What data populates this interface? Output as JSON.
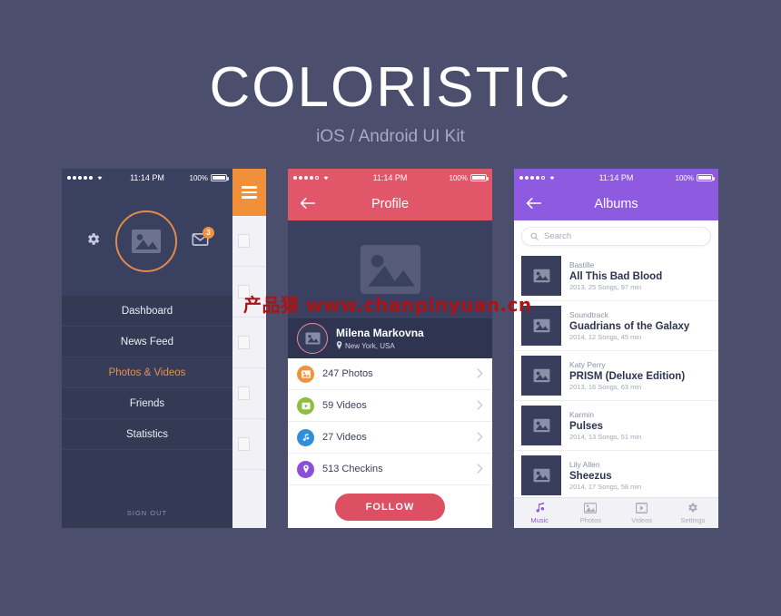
{
  "brand": {
    "title": "COLORISTIC",
    "subtitle": "iOS / Android UI Kit"
  },
  "watermark": "产品猿 www.chanpinyuan.cn",
  "colors": {
    "page_bg": "#4b4e6d",
    "sidebar_accent": "#e3924c",
    "sidebar_bg": "#343a54",
    "profile_accent": "#e2566a",
    "albums_accent": "#8e5ae0",
    "hamburger_orange": "#f2903a"
  },
  "phone1": {
    "status": {
      "time": "11:14 PM",
      "battery_percent": "100%",
      "signal_dots": 5,
      "signal_hollow": 0
    },
    "header": {
      "gear_icon": "gear-icon",
      "avatar_icon": "image-placeholder-icon",
      "mail_icon": "mail-icon",
      "mail_badge": "3"
    },
    "menu": [
      {
        "label": "Dashboard",
        "active": false
      },
      {
        "label": "News Feed",
        "active": false
      },
      {
        "label": "Photos & Videos",
        "active": true
      },
      {
        "label": "Friends",
        "active": false
      },
      {
        "label": "Statistics",
        "active": false
      }
    ],
    "sign_out": "SIGN OUT",
    "hamburger_icon": "hamburger-menu-icon"
  },
  "phone2": {
    "status": {
      "time": "11:14 PM",
      "battery_percent": "100%",
      "signal_dots": 4,
      "signal_hollow": 1
    },
    "nav": {
      "back_icon": "arrow-left-icon",
      "title": "Profile"
    },
    "cover_icon": "image-placeholder-icon",
    "user": {
      "avatar_icon": "image-placeholder-icon",
      "name": "Milena Markovna",
      "location_icon": "map-pin-icon",
      "location": "New York, USA"
    },
    "stats": [
      {
        "label": "247 Photos",
        "icon": "photo-icon",
        "color": "#f0923c",
        "glyph": "❑"
      },
      {
        "label": "59 Videos",
        "icon": "video-icon",
        "color": "#8cbf3f",
        "glyph": "▶"
      },
      {
        "label": "27 Videos",
        "icon": "music-icon",
        "color": "#2f8fdc",
        "glyph": "♫"
      },
      {
        "label": "513 Checkins",
        "icon": "map-pin-icon",
        "color": "#8a4fd6",
        "glyph": "◉"
      }
    ],
    "chevron_icon": "chevron-right-icon",
    "follow_button": "FOLLOW"
  },
  "phone3": {
    "status": {
      "time": "11:14 PM",
      "battery_percent": "100%",
      "signal_dots": 4,
      "signal_hollow": 1
    },
    "nav": {
      "back_icon": "arrow-left-icon",
      "title": "Albums"
    },
    "search": {
      "placeholder": "Search",
      "icon": "search-icon"
    },
    "albums": [
      {
        "artist": "Bastille",
        "title": "All This Bad Blood",
        "meta": "2013, 25 Songs, 97 min"
      },
      {
        "artist": "Soundtrack",
        "title": "Guadrians of the Galaxy",
        "meta": "2014, 12 Songs, 45 min"
      },
      {
        "artist": "Katy Perry",
        "title": "PRISM (Deluxe Edition)",
        "meta": "2013, 16 Songs, 63 min"
      },
      {
        "artist": "Karmin",
        "title": "Pulses",
        "meta": "2014, 13 Songs, 51 min"
      },
      {
        "artist": "Lily Allen",
        "title": "Sheezus",
        "meta": "2014, 17 Songs, 58 min"
      }
    ],
    "tabs": [
      {
        "label": "Music",
        "icon": "music-note-icon",
        "active": true
      },
      {
        "label": "Photos",
        "icon": "photo-icon",
        "active": false
      },
      {
        "label": "Videos",
        "icon": "film-icon",
        "active": false
      },
      {
        "label": "Settings",
        "icon": "gear-icon",
        "active": false
      }
    ]
  }
}
